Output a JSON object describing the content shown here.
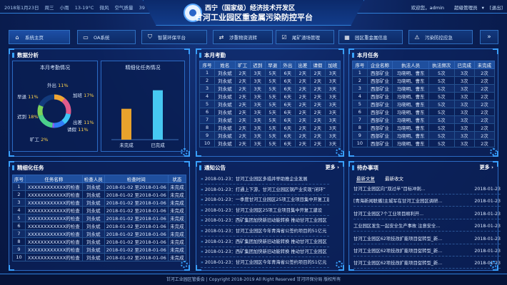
{
  "header": {
    "date": "2018年1月23日",
    "weekday": "周三",
    "weather": "小雨",
    "temperature": "13-19°C",
    "wind": "微风",
    "air_quality": "空气质量",
    "aqi": "39",
    "title_line1": "西宁（国家级）经济技术开发区",
    "title_line2": "甘河工业园区重金属污染防控平台",
    "welcome": "欢迎您，admin",
    "role": "超级管理员",
    "role_arrow": "▾",
    "logout": "[退出]"
  },
  "nav": {
    "items": [
      {
        "label": "系统主页",
        "icon": "home-icon"
      },
      {
        "label": "OA系统",
        "icon": "folder-icon"
      },
      {
        "label": "智慧环保平台",
        "icon": "shield-icon"
      },
      {
        "label": "涉重物资流转",
        "icon": "transfer-icon"
      },
      {
        "label": "尾矿渣场管理",
        "icon": "check-icon"
      },
      {
        "label": "园区重金属信息",
        "icon": "grid-icon"
      },
      {
        "label": "污染防控应急",
        "icon": "alarm-icon"
      }
    ]
  },
  "analysis": {
    "title": "数据分析",
    "attendance_title": "本月考勤情况",
    "labels": [
      {
        "name": "外出",
        "pct": "11%"
      },
      {
        "name": "加班",
        "pct": "17%"
      },
      {
        "name": "早退",
        "pct": "11%"
      },
      {
        "name": "迟到",
        "pct": "18%"
      },
      {
        "name": "出差",
        "pct": "11%"
      },
      {
        "name": "请假",
        "pct": "11%"
      },
      {
        "name": "旷工",
        "pct": "2%"
      }
    ],
    "task_title": "精细化任务情况",
    "bars": [
      {
        "label": "未完成",
        "value": 25,
        "color": "#e8a22c"
      },
      {
        "label": "已完成",
        "value": 40,
        "color": "#46c8f2"
      }
    ],
    "bar_max": 45
  },
  "attendance": {
    "title": "本月考勤",
    "columns": [
      "序号",
      "姓名",
      "旷工",
      "迟到",
      "早退",
      "外出",
      "出差",
      "请假",
      "加班"
    ],
    "rows": [
      [
        "1",
        "刘永斌",
        "2天",
        "3天",
        "5天",
        "6天",
        "2天",
        "2天",
        "3天"
      ],
      [
        "2",
        "刘永斌",
        "2天",
        "3天",
        "5天",
        "6天",
        "2天",
        "2天",
        "3天"
      ],
      [
        "3",
        "刘永斌",
        "2天",
        "3天",
        "5天",
        "6天",
        "2天",
        "2天",
        "3天"
      ],
      [
        "4",
        "刘永斌",
        "2天",
        "3天",
        "5天",
        "6天",
        "2天",
        "2天",
        "3天"
      ],
      [
        "5",
        "刘永斌",
        "2天",
        "3天",
        "5天",
        "6天",
        "2天",
        "2天",
        "3天"
      ],
      [
        "6",
        "刘永斌",
        "2天",
        "3天",
        "5天",
        "6天",
        "2天",
        "2天",
        "3天"
      ],
      [
        "7",
        "刘永斌",
        "2天",
        "3天",
        "5天",
        "6天",
        "2天",
        "2天",
        "3天"
      ],
      [
        "8",
        "刘永斌",
        "2天",
        "3天",
        "5天",
        "6天",
        "2天",
        "2天",
        "3天"
      ],
      [
        "9",
        "刘永斌",
        "2天",
        "3天",
        "5天",
        "6天",
        "2天",
        "2天",
        "3天"
      ],
      [
        "10",
        "刘永斌",
        "2天",
        "3天",
        "5天",
        "6天",
        "2天",
        "2天",
        "3天"
      ]
    ]
  },
  "monthly_tasks": {
    "title": "本月任务",
    "columns": [
      "序号",
      "企业名称",
      "执法人员",
      "执法频次",
      "已完成",
      "未完成"
    ],
    "rows": [
      [
        "1",
        "西部矿业",
        "马晓明、曹东",
        "5次",
        "3次",
        "2次"
      ],
      [
        "2",
        "西部矿业",
        "马晓明、曹东",
        "5次",
        "3次",
        "2次"
      ],
      [
        "3",
        "西部矿业",
        "马晓明、曹东",
        "5次",
        "3次",
        "2次"
      ],
      [
        "4",
        "西部矿业",
        "马晓明、曹东",
        "5次",
        "3次",
        "2次"
      ],
      [
        "5",
        "西部矿业",
        "马晓明、曹东",
        "5次",
        "3次",
        "2次"
      ],
      [
        "6",
        "西部矿业",
        "马晓明、曹东",
        "5次",
        "3次",
        "2次"
      ],
      [
        "7",
        "西部矿业",
        "马晓明、曹东",
        "5次",
        "3次",
        "2次"
      ],
      [
        "8",
        "西部矿业",
        "马晓明、曹东",
        "5次",
        "3次",
        "2次"
      ],
      [
        "9",
        "西部矿业",
        "马晓明、曹东",
        "5次",
        "3次",
        "2次"
      ],
      [
        "10",
        "西部矿业",
        "马晓明、曹东",
        "5次",
        "3次",
        "2次"
      ]
    ]
  },
  "fine_tasks": {
    "title": "精细化任务",
    "columns": [
      "序号",
      "任务名称",
      "检查人员",
      "检查时间",
      "状态"
    ],
    "rows": [
      [
        "1",
        "XXXXXXXXXXXX的检查",
        "刘永斌",
        "2018-01-02 至2018-01-06",
        "未完成"
      ],
      [
        "2",
        "XXXXXXXXXXXX的检查",
        "刘永斌",
        "2018-01-02 至2018-01-06",
        "未完成"
      ],
      [
        "3",
        "XXXXXXXXXXXX的检查",
        "刘永斌",
        "2018-01-02 至2018-01-06",
        "未完成"
      ],
      [
        "4",
        "XXXXXXXXXXXX的检查",
        "刘永斌",
        "2018-01-02 至2018-01-06",
        "未完成"
      ],
      [
        "5",
        "XXXXXXXXXXXX的检查",
        "刘永斌",
        "2018-01-02 至2018-01-06",
        "未完成"
      ],
      [
        "6",
        "XXXXXXXXXXXX的检查",
        "刘永斌",
        "2018-01-02 至2018-01-06",
        "未完成"
      ],
      [
        "7",
        "XXXXXXXXXXXX的检查",
        "刘永斌",
        "2018-01-02 至2018-01-06",
        "未完成"
      ],
      [
        "8",
        "XXXXXXXXXXXX的检查",
        "刘永斌",
        "2018-01-02 至2018-01-06",
        "未完成"
      ],
      [
        "9",
        "XXXXXXXXXXXX的检查",
        "刘永斌",
        "2018-01-02 至2018-01-06",
        "未完成"
      ],
      [
        "10",
        "XXXXXXXXXXXX的检查",
        "刘永斌",
        "2018-01-02 至2018-01-06",
        "未完成"
      ]
    ]
  },
  "notices": {
    "title": "通知公告",
    "more": "更多",
    "items": [
      "2018-01-23：甘河工业园区多措并举助推企业发展",
      "2018-01-23：打通上下游，甘河工业园区钢产业实现“闭环”",
      "2018-01-23：一季度甘河工业园区25项工业项目集中开复工建设",
      "2018-01-23：甘河工业园区25项工业项目集中开复工建设",
      "2018-01-23：西矿集团加快新旧动能转换 推动甘河工业园区",
      "2018-01-23：甘河工业园区今年青海省公签约项目的51亿元",
      "2018-01-23：西矿集团加快新旧动能转换 推动甘河工业园区",
      "2018-01-23：西矿集团加快新旧动能转换 推动甘河工业园区",
      "2018-01-23：甘河工业园区今年青海省公签约项目的51亿元"
    ]
  },
  "todo": {
    "title": "待办事项",
    "more": "更多",
    "tabs": [
      "最新文复",
      "最新收文"
    ],
    "items": [
      {
        "text": "甘河工业园区向“双过半”目标冲刺...",
        "date": "2018-01-23"
      },
      {
        "text": "[青海新闻联播]主城军在甘河工业园区调研...",
        "date": "2018-01-23"
      },
      {
        "text": "甘河工业园区7个工业项目顺利开...",
        "date": "2018-01-23"
      },
      {
        "text": "工业园区发生一起安全生产事故 注意安全...",
        "date": "2018-01-23"
      },
      {
        "text": "甘河工业园区62项技改扩能项目促转型_新...",
        "date": "2018-01-23"
      },
      {
        "text": "甘河工业园区62项技改扩能项目促转型_新...",
        "date": "2018-01-23"
      },
      {
        "text": "甘河工业园区62项技改扩能项目促转型_新...",
        "date": "2018-01-23"
      }
    ]
  },
  "footer": {
    "org": "甘河工业园区管委会",
    "copyright": "| Copyright  2018-2019  All Right Reserved",
    "rights": "甘河环保分局  版权所有"
  }
}
